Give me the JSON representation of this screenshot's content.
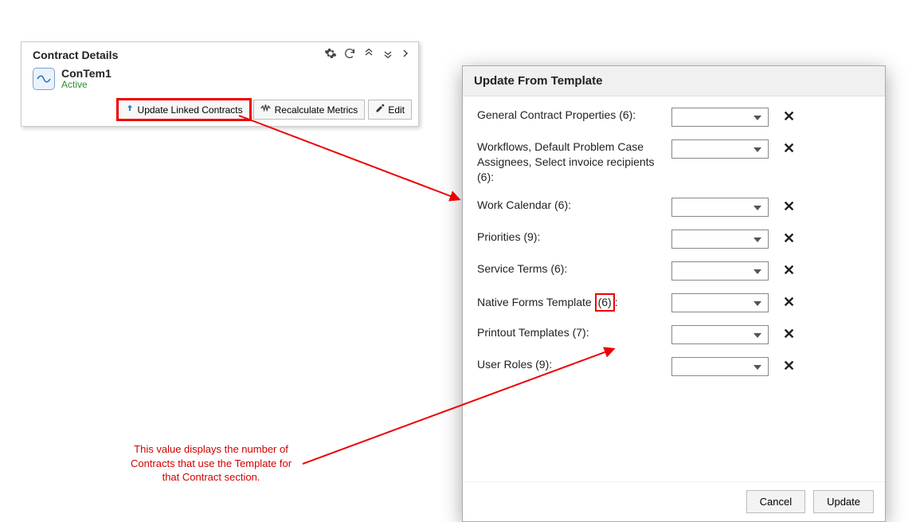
{
  "panel": {
    "title": "Contract Details",
    "object_name": "ConTem1",
    "object_status": "Active",
    "buttons": {
      "update_linked": "Update Linked Contracts",
      "recalc": "Recalculate Metrics",
      "edit": "Edit"
    }
  },
  "dialog": {
    "title": "Update From Template",
    "rows": [
      {
        "label": "General Contract Properties (6):"
      },
      {
        "label": "Workflows, Default Problem Case Assignees, Select invoice recipients (6):"
      },
      {
        "label": "Work Calendar (6):"
      },
      {
        "label": "Priorities (9):"
      },
      {
        "label": "Service Terms (6):"
      },
      {
        "label_pre": "Native Forms Template ",
        "count": "(6)",
        "label_post": ":"
      },
      {
        "label": "Printout Templates (7):"
      },
      {
        "label": "User Roles (9):"
      }
    ],
    "footer": {
      "cancel": "Cancel",
      "update": "Update"
    }
  },
  "annotation": "This value displays the number of Contracts that use the Template for that Contract section."
}
